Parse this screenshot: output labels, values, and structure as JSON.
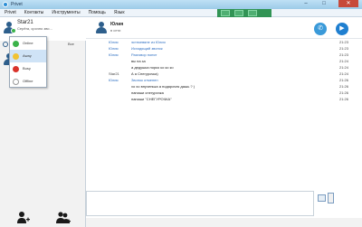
{
  "window": {
    "title": "Privet",
    "minimize": "–",
    "maximize": "□",
    "close": "✕"
  },
  "menu": [
    "Privet",
    "Контакты",
    "Инструменты",
    "Помощь",
    "Язык"
  ],
  "me": {
    "name": "Star21",
    "status_message": "Серёга, срочно зво..."
  },
  "contacts_tab": {
    "all_label": "Все"
  },
  "status_menu": {
    "items": [
      {
        "label": "Online",
        "color": "#3bb34a",
        "selected": false
      },
      {
        "label": "Away",
        "color": "#f1c232",
        "selected": true
      },
      {
        "label": "Busy",
        "color": "#d9332b",
        "selected": false
      },
      {
        "label": "Offline",
        "color": "#bdbdbd",
        "selected": false
      }
    ]
  },
  "chat": {
    "name": "Юлия",
    "subtitle": "в сети",
    "messages": [
      {
        "from": "Юлия",
        "text": "эстекевяне из Юлия",
        "time": "21:23",
        "mine": false
      },
      {
        "from": "Юлия",
        "text": "Исходящий звонок",
        "time": "21:23",
        "mine": false
      },
      {
        "from": "Юлия",
        "text": "Разговор понят",
        "time": "21:23",
        "mine": false
      },
      {
        "from": "",
        "text": "вы на за",
        "time": "21:24",
        "mine": true
      },
      {
        "from": "",
        "text": "а дедушка норко ко ко ко",
        "time": "21:24",
        "mine": true
      },
      {
        "from": "Star21",
        "text": "А а Снегурочка)",
        "time": "21:24",
        "mine": true
      },
      {
        "from": "Юлия",
        "text": "Звонок отменен",
        "time": "21:26",
        "mine": false
      },
      {
        "from": "",
        "text": "хо хо внученька а подарочек дашь ? )",
        "time": "21:26",
        "mine": true
      },
      {
        "from": "",
        "text": "напиши снегуричка",
        "time": "21:26",
        "mine": true
      },
      {
        "from": "",
        "text": "напиши \"СНЕГУРОЧКА\"",
        "time": "21:26",
        "mine": true
      }
    ]
  },
  "colors": {
    "accent": "#2e6fc2",
    "titlebar": "#9ccbe8",
    "call": "#3a9ad9"
  }
}
